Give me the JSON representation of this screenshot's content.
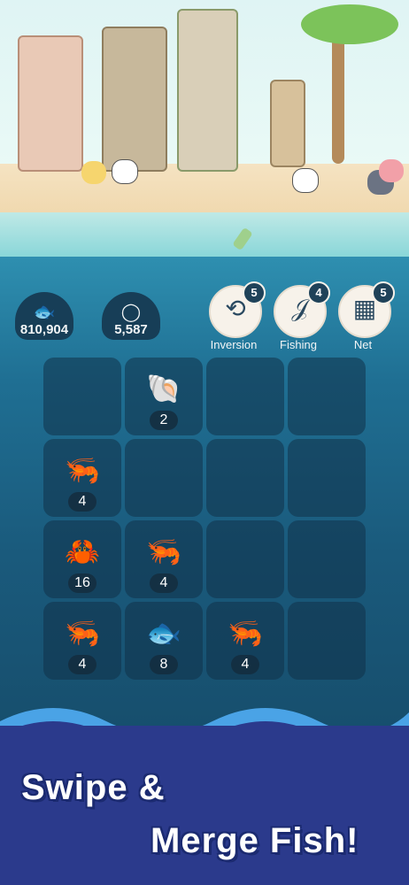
{
  "counters": {
    "fish": {
      "icon": "fish-icon",
      "glyph": "🐟",
      "value": "810,904"
    },
    "pearl": {
      "icon": "pearl-icon",
      "glyph": "◯",
      "value": "5,587"
    }
  },
  "tools": [
    {
      "name": "inversion",
      "label": "Inversion",
      "count": "5",
      "glyph": "⟲",
      "icon": "inversion-icon"
    },
    {
      "name": "fishing",
      "label": "Fishing",
      "count": "4",
      "glyph": "𝒥",
      "icon": "fishing-rod-icon"
    },
    {
      "name": "net",
      "label": "Net",
      "count": "5",
      "glyph": "▦",
      "icon": "net-icon"
    }
  ],
  "grid": [
    [
      {
        "item": "",
        "glyph": "",
        "value": ""
      },
      {
        "item": "shell",
        "glyph": "🐚",
        "value": "2"
      },
      {
        "item": "",
        "glyph": "",
        "value": ""
      },
      {
        "item": "",
        "glyph": "",
        "value": ""
      }
    ],
    [
      {
        "item": "shrimp",
        "glyph": "🦐",
        "value": "4"
      },
      {
        "item": "",
        "glyph": "",
        "value": ""
      },
      {
        "item": "",
        "glyph": "",
        "value": ""
      },
      {
        "item": "",
        "glyph": "",
        "value": ""
      }
    ],
    [
      {
        "item": "crab",
        "glyph": "🦀",
        "value": "16"
      },
      {
        "item": "shrimp",
        "glyph": "🦐",
        "value": "4"
      },
      {
        "item": "",
        "glyph": "",
        "value": ""
      },
      {
        "item": "",
        "glyph": "",
        "value": ""
      }
    ],
    [
      {
        "item": "shrimp",
        "glyph": "🦐",
        "value": "4"
      },
      {
        "item": "sardine",
        "glyph": "🐟",
        "value": "8"
      },
      {
        "item": "shrimp",
        "glyph": "🦐",
        "value": "4"
      },
      {
        "item": "",
        "glyph": "",
        "value": ""
      }
    ]
  ],
  "promo": {
    "line1": "Swipe &",
    "line2": "Merge Fish!"
  },
  "colors": {
    "board": "#1a5a7c",
    "banner": "#2b3a8c",
    "badge": "#1f4259"
  }
}
